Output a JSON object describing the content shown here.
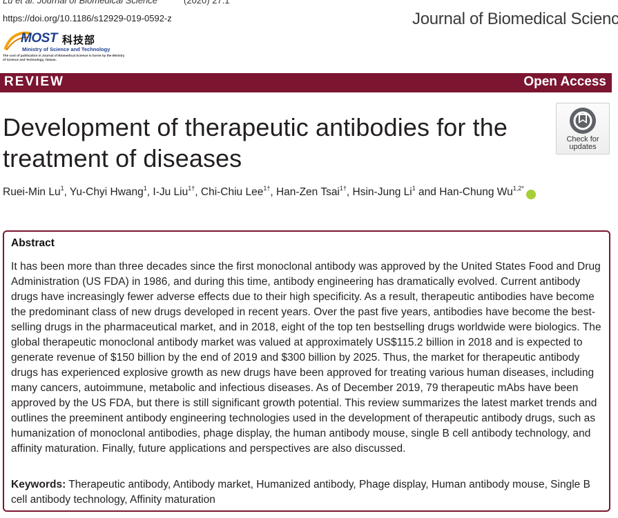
{
  "header": {
    "citation": "Lu et al. Journal of Biomedical Science",
    "volume": "(2020) 27:1",
    "doi": "https://doi.org/10.1186/s12929-019-0592-z",
    "journal_name": "Journal of Biomedical Science"
  },
  "logo": {
    "wordmark": "MOST",
    "cjk": "科技部",
    "ministry": "Ministry of Science and Technology",
    "note": "The cost of publication in Journal of Biomedical Science is borne by the Ministry of Science and Technology, Taiwan."
  },
  "bar": {
    "article_type": "REVIEW",
    "access": "Open Access",
    "color": "#7b1530"
  },
  "updates_badge": {
    "label_line1": "Check for",
    "label_line2": "updates"
  },
  "article": {
    "title": "Development of therapeutic antibodies for the treatment of diseases",
    "authors": [
      {
        "name": "Ruei-Min Lu",
        "sup": "1",
        "sep": ", "
      },
      {
        "name": "Yu-Chyi Hwang",
        "sup": "1",
        "sep": ", "
      },
      {
        "name": "I-Ju Liu",
        "sup": "1†",
        "sep": ", "
      },
      {
        "name": "Chi-Chiu Lee",
        "sup": "1†",
        "sep": ", "
      },
      {
        "name": "Han-Zen Tsai",
        "sup": "1†",
        "sep": ", "
      },
      {
        "name": "Hsin-Jung Li",
        "sup": "1",
        "sep": " and "
      },
      {
        "name": "Han-Chung Wu",
        "sup": "1,2*",
        "sep": ""
      }
    ],
    "orcid_icon": "orcid-icon"
  },
  "abstract": {
    "heading": "Abstract",
    "text": "It has been more than three decades since the first monoclonal antibody was approved by the United States Food and Drug Administration (US FDA) in 1986, and during this time, antibody engineering has dramatically evolved. Current antibody drugs have increasingly fewer adverse effects due to their high specificity. As a result, therapeutic antibodies have become the predominant class of new drugs developed in recent years. Over the past five years, antibodies have become the best-selling drugs in the pharmaceutical market, and in 2018, eight of the top ten bestselling drugs worldwide were biologics. The global therapeutic monoclonal antibody market was valued at approximately US$115.2 billion in 2018 and is expected to generate revenue of $150 billion by the end of 2019 and $300 billion by 2025. Thus, the market for therapeutic antibody drugs has experienced explosive growth as new drugs have been approved for treating various human diseases, including many cancers, autoimmune, metabolic and infectious diseases. As of December 2019, 79 therapeutic mAbs have been approved by the US FDA, but there is still significant growth potential. This review summarizes the latest market trends and outlines the preeminent antibody engineering technologies used in the development of therapeutic antibody drugs, such as humanization of monoclonal antibodies, phage display, the human antibody mouse, single B cell antibody technology, and affinity maturation. Finally, future applications and perspectives are also discussed.",
    "keywords_label": "Keywords:",
    "keywords": "Therapeutic antibody, Antibody market, Humanized antibody, Phage display, Human antibody mouse, Single B cell antibody technology, Affinity maturation"
  }
}
